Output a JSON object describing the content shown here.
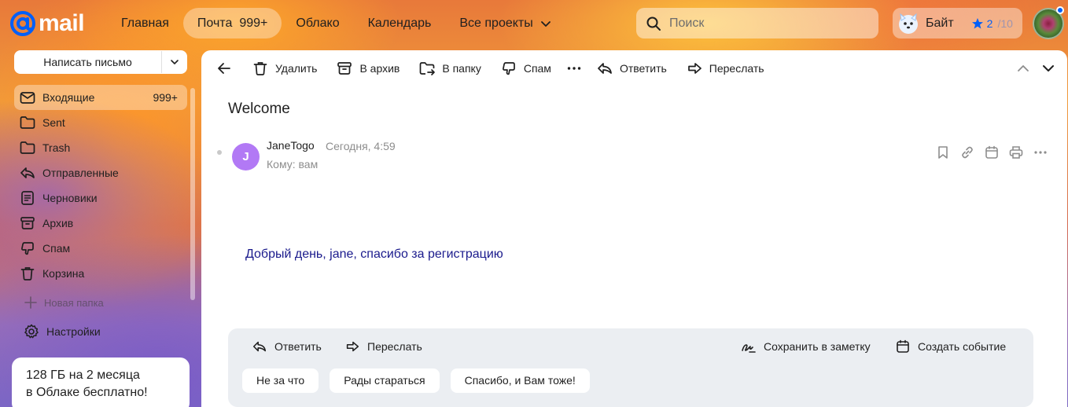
{
  "header": {
    "logo_text": "mail",
    "nav": [
      {
        "label": "Главная",
        "active": false
      },
      {
        "label": "Почта",
        "count": "999+",
        "active": true
      },
      {
        "label": "Облако",
        "active": false
      },
      {
        "label": "Календарь",
        "active": false
      },
      {
        "label": "Все проекты",
        "active": false
      }
    ],
    "search_placeholder": "Поиск",
    "bait": {
      "label": "Байт",
      "count": "2",
      "count_secondary": "/10"
    }
  },
  "sidebar": {
    "compose_label": "Написать письмо",
    "folders": [
      {
        "label": "Входящие",
        "count": "999+",
        "icon": "mail-icon",
        "active": true
      },
      {
        "label": "Sent",
        "icon": "folder-icon"
      },
      {
        "label": "Trash",
        "icon": "folder-icon"
      },
      {
        "label": "Отправленные",
        "icon": "sent-icon"
      },
      {
        "label": "Черновики",
        "icon": "draft-icon"
      },
      {
        "label": "Архив",
        "icon": "archive-icon"
      },
      {
        "label": "Спам",
        "icon": "spam-icon"
      },
      {
        "label": "Корзина",
        "icon": "trash-icon"
      }
    ],
    "new_folder_label": "Новая папка",
    "settings_label": "Настройки",
    "promo": {
      "line1": "128 ГБ на 2 месяца",
      "line2": "в Облаке бесплатно!"
    }
  },
  "toolbar": {
    "delete": "Удалить",
    "archive": "В архив",
    "move": "В папку",
    "spam": "Спам",
    "reply": "Ответить",
    "forward": "Переслать"
  },
  "message": {
    "subject": "Welcome",
    "sender_initial": "J",
    "sender_name": "JaneTogo",
    "time": "Сегодня, 4:59",
    "recipient": "Кому: вам",
    "body": "Добрый день, jane, спасибо за регистрацию"
  },
  "quick_reply": {
    "reply": "Ответить",
    "forward": "Переслать",
    "save_note": "Сохранить в заметку",
    "create_event": "Создать событие",
    "chips": [
      "Не за что",
      "Рады стараться",
      "Спасибо, и Вам тоже!"
    ]
  },
  "colors": {
    "accent": "#005ff9",
    "sender_avatar": "#b279f5",
    "body_text": "#1a1a8c"
  }
}
